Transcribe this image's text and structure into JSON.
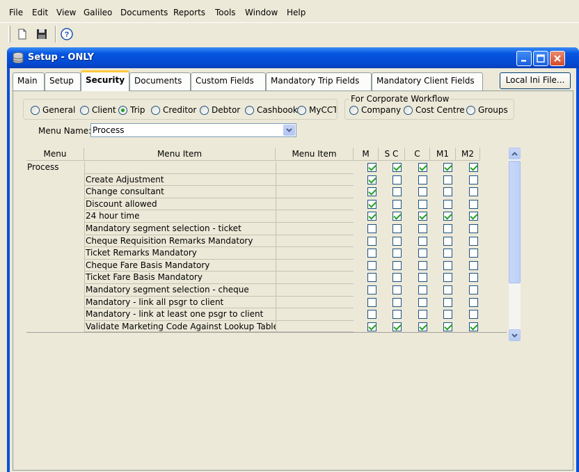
{
  "menubar": [
    "File",
    "Edit",
    "View",
    "Galileo",
    "Documents",
    "Reports",
    "Tools",
    "Window",
    "Help"
  ],
  "toolbar": {
    "new_icon": "new-document-icon",
    "save_icon": "save-disk-icon",
    "help_icon": "help-icon"
  },
  "window": {
    "title": "Setup - ONLY"
  },
  "tabs": [
    "Main",
    "Setup",
    "Security",
    "Documents",
    "Custom Fields",
    "Mandatory Trip Fields",
    "Mandatory Client Fields"
  ],
  "active_tab": "Security",
  "local_ini_button": "Local Ini File...",
  "radio_group1": {
    "options": [
      "General",
      "Client",
      "Trip",
      "Creditor",
      "Debtor",
      "Cashbook",
      "MyCCT"
    ],
    "selected": "Trip"
  },
  "radio_group2": {
    "label": "For Corporate Workflow",
    "options": [
      "Company",
      "Cost Centre",
      "Groups"
    ]
  },
  "menu_name": {
    "label": "Menu Name:",
    "value": "Process"
  },
  "grid": {
    "headers": [
      "Menu",
      "Menu Item",
      "Menu Item",
      "M",
      "S C",
      "C",
      "M1",
      "M2"
    ],
    "rows": [
      {
        "menu": "Process",
        "item": "",
        "checks": [
          true,
          true,
          true,
          true,
          true
        ]
      },
      {
        "menu": "",
        "item": "Create Adjustment",
        "checks": [
          true,
          false,
          false,
          false,
          false
        ]
      },
      {
        "menu": "",
        "item": "Change consultant",
        "checks": [
          true,
          false,
          false,
          false,
          false
        ]
      },
      {
        "menu": "",
        "item": "Discount allowed",
        "checks": [
          true,
          false,
          false,
          false,
          false
        ]
      },
      {
        "menu": "",
        "item": "24 hour time",
        "checks": [
          true,
          true,
          true,
          true,
          true
        ]
      },
      {
        "menu": "",
        "item": "Mandatory segment selection - ticket",
        "checks": [
          false,
          false,
          false,
          false,
          false
        ]
      },
      {
        "menu": "",
        "item": "Cheque Requisition Remarks Mandatory",
        "checks": [
          false,
          false,
          false,
          false,
          false
        ]
      },
      {
        "menu": "",
        "item": "Ticket Remarks Mandatory",
        "checks": [
          false,
          false,
          false,
          false,
          false
        ]
      },
      {
        "menu": "",
        "item": "Cheque Fare Basis Mandatory",
        "checks": [
          false,
          false,
          false,
          false,
          false
        ]
      },
      {
        "menu": "",
        "item": "Ticket Fare Basis Mandatory",
        "checks": [
          false,
          false,
          false,
          false,
          false
        ]
      },
      {
        "menu": "",
        "item": "Mandatory segment selection - cheque",
        "checks": [
          false,
          false,
          false,
          false,
          false
        ]
      },
      {
        "menu": "",
        "item": "Mandatory - link all psgr to client",
        "checks": [
          false,
          false,
          false,
          false,
          false
        ]
      },
      {
        "menu": "",
        "item": "Mandatory - link at least one psgr to client",
        "checks": [
          false,
          false,
          false,
          false,
          false
        ]
      },
      {
        "menu": "",
        "item": "Validate Marketing Code Against Lookup Table",
        "checks": [
          true,
          true,
          true,
          true,
          true
        ]
      }
    ]
  }
}
